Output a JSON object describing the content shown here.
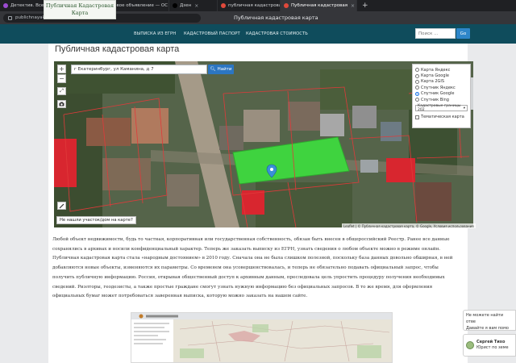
{
  "browser": {
    "tabs": [
      {
        "label": "Детектив. Все ко",
        "active": false,
        "favicon_color": "#9c4bd1"
      },
      {
        "label": "Дзен",
        "active": false,
        "favicon_color": "#000000"
      },
      {
        "label": "Новое объявление — ОС",
        "active": false,
        "favicon_color": "#ff9800"
      },
      {
        "label": "Дзен",
        "active": false,
        "favicon_color": "#000000"
      },
      {
        "label": "публичная кадастровая к",
        "active": false,
        "favicon_color": "#e0493b"
      },
      {
        "label": "Публичная кадастровая",
        "active": true,
        "favicon_color": "#e0493b"
      }
    ],
    "new_tab": "+",
    "url": "publichnayakadastrovayakarta.ru",
    "window_title": "Публичная кадастровая карта"
  },
  "header": {
    "logo_line1": "Публичная Кадастровая",
    "logo_line2": "Карта",
    "nav": [
      "ВЫПИСКА ИЗ ЕГРН",
      "КАДАСТРОВЫЙ ПАСПОРТ",
      "КАДАСТРОВАЯ СТОИМОСТЬ"
    ],
    "search_placeholder": "Поиск ...",
    "search_button": "Go"
  },
  "page": {
    "title": "Публичная кадастровая карта"
  },
  "map": {
    "zoom_in": "+",
    "zoom_out": "−",
    "address_value": "г Екатеринбург, ул Каманина, д 7",
    "find_button": "Найти",
    "layers": [
      {
        "label": "Карта Яндекс",
        "selected": false
      },
      {
        "label": "Карта Google",
        "selected": false
      },
      {
        "label": "Карта 2GIS",
        "selected": false
      },
      {
        "label": "Спутник Яндекс",
        "selected": false
      },
      {
        "label": "Спутник Google",
        "selected": true
      },
      {
        "label": "Спутник Bing",
        "selected": false
      }
    ],
    "cadastral_select": "Кадастровые границы 202",
    "thematic_label": "Тематическая карта",
    "not_found": "Не нашли участок/дом на карте?",
    "attribution": "Leaflet | © Публичная кадастровая карта, © Google, Условия использования",
    "colors": {
      "parcel_fill": "#3fd33f",
      "boundary": "#e03a3a",
      "roof_red": "#d8262f"
    }
  },
  "article": {
    "paragraph": "Любой объект недвижимости, будь то частная, корпоративная или государственная собственность, обязан быть внесен в общероссийский Реестр. Ранее все данные сохранялись в архивах и носили конфиденциальный характер. Теперь же заказать выписку из ЕГРН, узнать сведения о любом объекте можно в режиме онлайн. Публичная кадастровая карта стала «народным достоянием» в 2010 году. Сначала она не была слишком полезной, поскольку база данных довольно обширная, в ней добавляются новые объекты, изменяются их параметры. Со временем она усовершенствовалась, и теперь не обязательно подавать официальный запрос, чтобы получить публичную информацию. Россия, открывая общественный доступ к архивным данным, преследовала цель упростить процедуру получения необходимых сведений. Риэлторы, геодезисты, а также простые граждане смогут узнать нужную информацию без официальных запросов. В то же время, для оформления официальных бумаг может потребоваться заверенная выписка, которую можно заказать на нашем сайте."
  },
  "chat": {
    "line1": "Не можете найти отве",
    "line2": "Давайте я вам помо",
    "agent_name": "Сергей Тихо",
    "agent_role": "Юрист по земе"
  }
}
